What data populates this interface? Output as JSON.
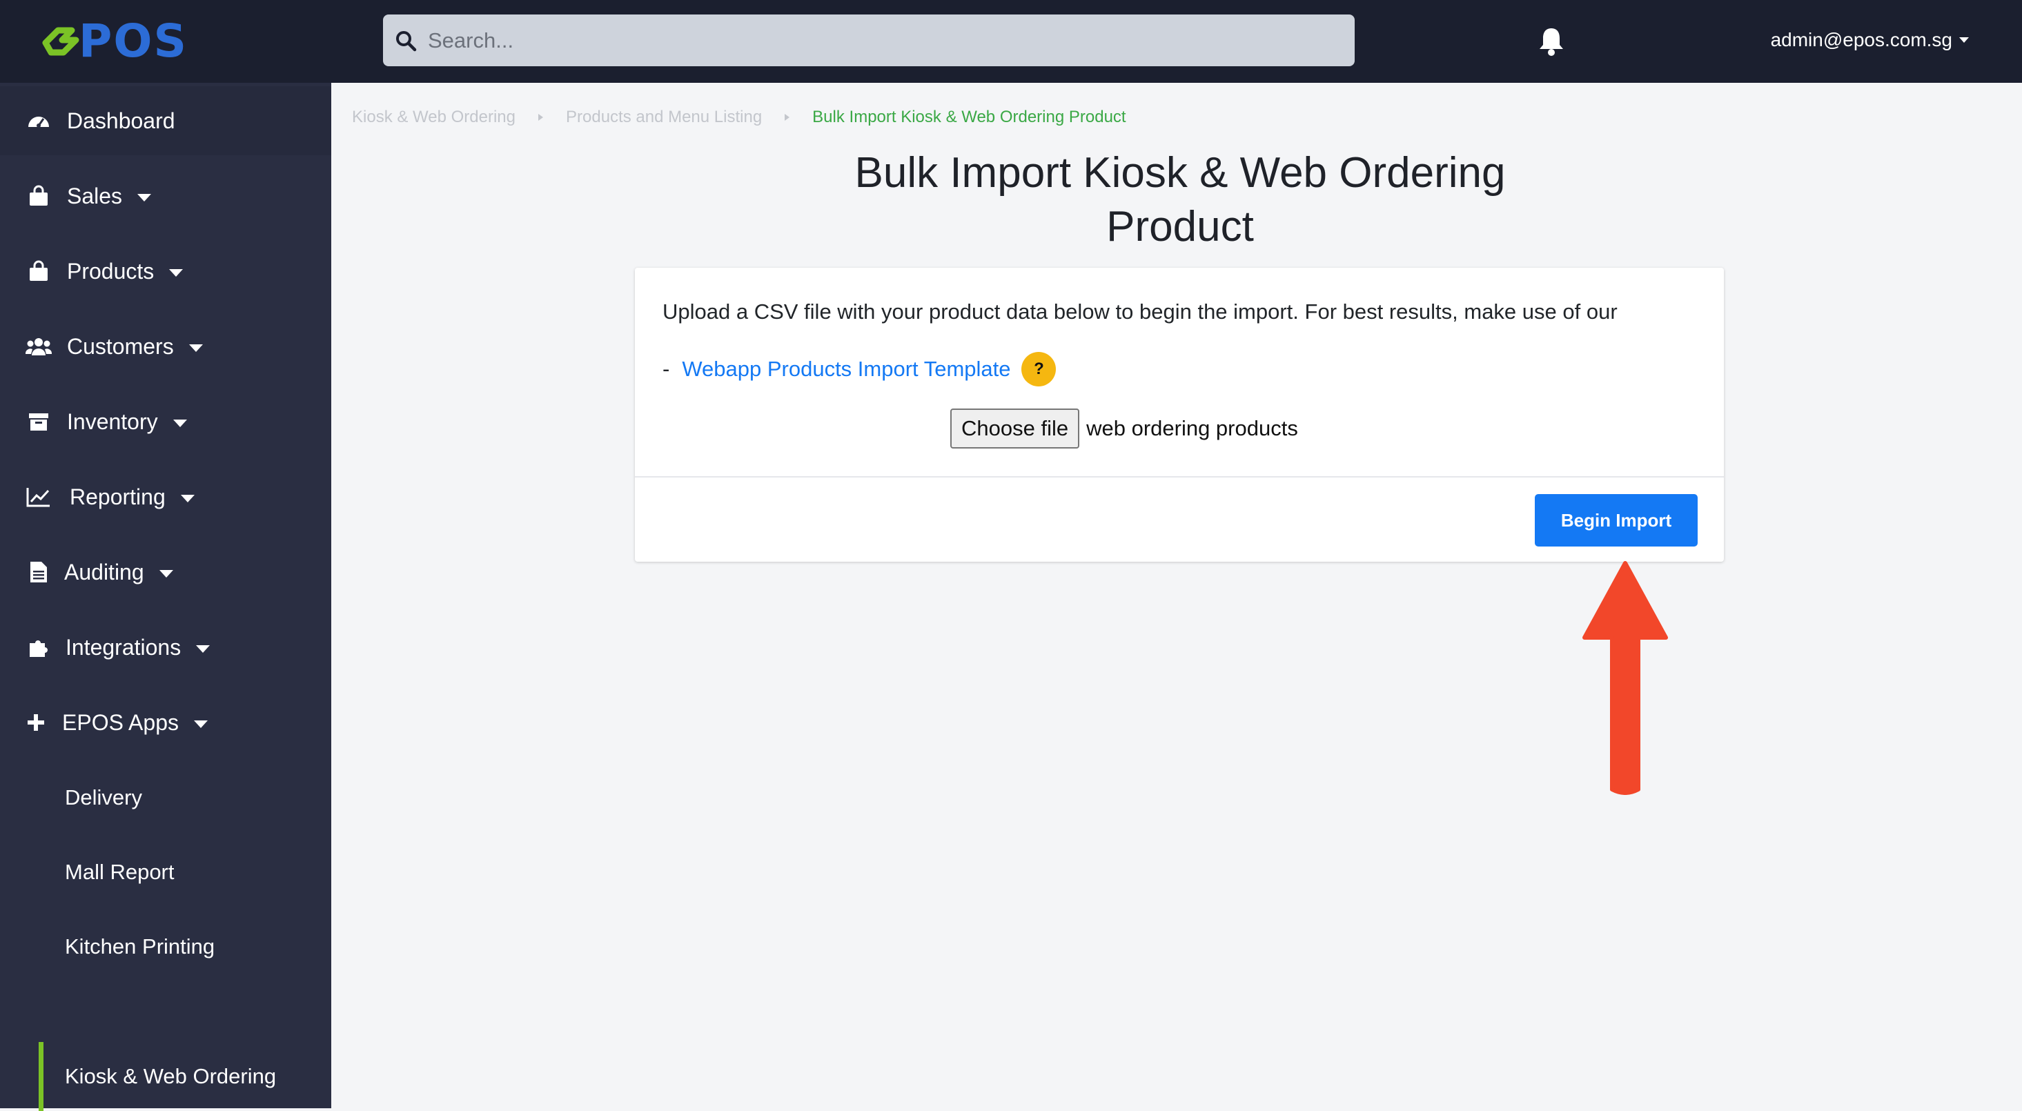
{
  "brand": {
    "logo_text": "POS",
    "logo_mark_color": "#7bc326",
    "logo_text_color": "#2c6cd6"
  },
  "search": {
    "placeholder": "Search..."
  },
  "header": {
    "user_email": "admin@epos.com.sg"
  },
  "sidebar": {
    "items": [
      {
        "label": "Dashboard",
        "icon": "dashboard-icon",
        "has_dropdown": false
      },
      {
        "label": "Sales",
        "icon": "shopping-bag-icon",
        "has_dropdown": true
      },
      {
        "label": "Products",
        "icon": "shopping-bag-icon",
        "has_dropdown": true
      },
      {
        "label": "Customers",
        "icon": "users-icon",
        "has_dropdown": true
      },
      {
        "label": "Inventory",
        "icon": "archive-box-icon",
        "has_dropdown": true
      },
      {
        "label": "Reporting",
        "icon": "line-chart-icon",
        "has_dropdown": true
      },
      {
        "label": "Auditing",
        "icon": "document-icon",
        "has_dropdown": true
      },
      {
        "label": "Integrations",
        "icon": "puzzle-icon",
        "has_dropdown": true
      },
      {
        "label": "EPOS Apps",
        "icon": "plus-icon",
        "has_dropdown": true
      }
    ],
    "sub_items": [
      {
        "label": "Delivery",
        "active": false
      },
      {
        "label": "Mall Report",
        "active": false
      },
      {
        "label": "Kitchen Printing",
        "active": false
      },
      {
        "label": "Kiosk & Web Ordering",
        "active": true
      }
    ]
  },
  "breadcrumb": [
    "Kiosk & Web Ordering",
    "Products and Menu Listing",
    "Bulk Import Kiosk & Web Ordering Product"
  ],
  "page": {
    "title_line1": "Bulk Import Kiosk & Web Ordering",
    "title_line2": "Product",
    "intro": "Upload a CSV file with your product data below to begin the import. For best results, make use of our",
    "template_dash": "-",
    "template_link": "Webapp Products Import Template",
    "help_icon_text": "?",
    "file_button": "Choose file",
    "file_name": "web ordering products",
    "import_button": "Begin Import"
  },
  "colors": {
    "topbar": "#1b1f2f",
    "sidebar": "#2a2e42",
    "primary": "#1479f4",
    "active_accent": "#7bc326",
    "breadcrumb_current": "#3aa845",
    "help_badge": "#f5b710",
    "annotation_arrow": "#f2472a"
  }
}
